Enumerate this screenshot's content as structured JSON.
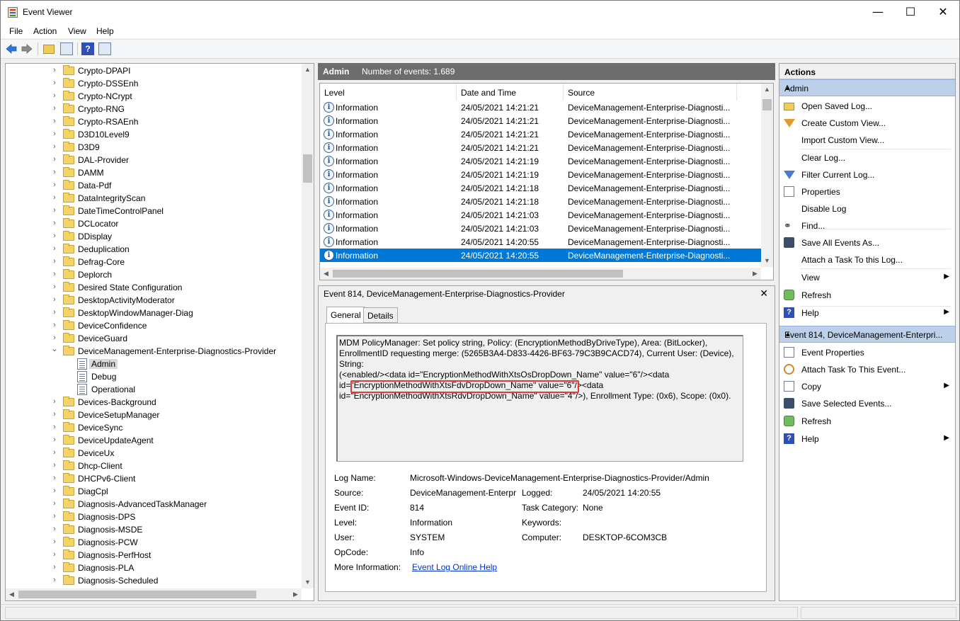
{
  "window": {
    "title": "Event Viewer",
    "minimize": "—",
    "maximize": "☐",
    "close": "✕"
  },
  "menu": [
    "File",
    "Action",
    "View",
    "Help"
  ],
  "toolbar": {
    "help_glyph": "?"
  },
  "tree": {
    "items": [
      {
        "label": "Crypto-DPAPI",
        "type": "folder",
        "expanded": false
      },
      {
        "label": "Crypto-DSSEnh",
        "type": "folder",
        "expanded": false
      },
      {
        "label": "Crypto-NCrypt",
        "type": "folder",
        "expanded": false
      },
      {
        "label": "Crypto-RNG",
        "type": "folder",
        "expanded": false
      },
      {
        "label": "Crypto-RSAEnh",
        "type": "folder",
        "expanded": false
      },
      {
        "label": "D3D10Level9",
        "type": "folder",
        "expanded": false
      },
      {
        "label": "D3D9",
        "type": "folder",
        "expanded": false
      },
      {
        "label": "DAL-Provider",
        "type": "folder",
        "expanded": false
      },
      {
        "label": "DAMM",
        "type": "folder",
        "expanded": false
      },
      {
        "label": "Data-Pdf",
        "type": "folder",
        "expanded": false
      },
      {
        "label": "DataIntegrityScan",
        "type": "folder",
        "expanded": false
      },
      {
        "label": "DateTimeControlPanel",
        "type": "folder",
        "expanded": false
      },
      {
        "label": "DCLocator",
        "type": "folder",
        "expanded": false
      },
      {
        "label": "DDisplay",
        "type": "folder",
        "expanded": false
      },
      {
        "label": "Deduplication",
        "type": "folder",
        "expanded": false
      },
      {
        "label": "Defrag-Core",
        "type": "folder",
        "expanded": false
      },
      {
        "label": "Deplorch",
        "type": "folder",
        "expanded": false
      },
      {
        "label": "Desired State Configuration",
        "type": "folder",
        "expanded": false
      },
      {
        "label": "DesktopActivityModerator",
        "type": "folder",
        "expanded": false
      },
      {
        "label": "DesktopWindowManager-Diag",
        "type": "folder",
        "expanded": false
      },
      {
        "label": "DeviceConfidence",
        "type": "folder",
        "expanded": false
      },
      {
        "label": "DeviceGuard",
        "type": "folder",
        "expanded": false
      },
      {
        "label": "DeviceManagement-Enterprise-Diagnostics-Provider",
        "type": "folder",
        "expanded": true
      },
      {
        "label": "Admin",
        "type": "log",
        "child": true,
        "selected": true
      },
      {
        "label": "Debug",
        "type": "log",
        "child": true
      },
      {
        "label": "Operational",
        "type": "log",
        "child": true
      },
      {
        "label": "Devices-Background",
        "type": "folder",
        "expanded": false
      },
      {
        "label": "DeviceSetupManager",
        "type": "folder",
        "expanded": false
      },
      {
        "label": "DeviceSync",
        "type": "folder",
        "expanded": false
      },
      {
        "label": "DeviceUpdateAgent",
        "type": "folder",
        "expanded": false
      },
      {
        "label": "DeviceUx",
        "type": "folder",
        "expanded": false
      },
      {
        "label": "Dhcp-Client",
        "type": "folder",
        "expanded": false
      },
      {
        "label": "DHCPv6-Client",
        "type": "folder",
        "expanded": false
      },
      {
        "label": "DiagCpl",
        "type": "folder",
        "expanded": false
      },
      {
        "label": "Diagnosis-AdvancedTaskManager",
        "type": "folder",
        "expanded": false
      },
      {
        "label": "Diagnosis-DPS",
        "type": "folder",
        "expanded": false
      },
      {
        "label": "Diagnosis-MSDE",
        "type": "folder",
        "expanded": false
      },
      {
        "label": "Diagnosis-PCW",
        "type": "folder",
        "expanded": false
      },
      {
        "label": "Diagnosis-PerfHost",
        "type": "folder",
        "expanded": false
      },
      {
        "label": "Diagnosis-PLA",
        "type": "folder",
        "expanded": false
      },
      {
        "label": "Diagnosis-Scheduled",
        "type": "folder",
        "expanded": false
      }
    ]
  },
  "log_header": {
    "name": "Admin",
    "count": "Number of events: 1.689"
  },
  "event_list": {
    "columns": [
      "Level",
      "Date and Time",
      "Source"
    ],
    "rows": [
      {
        "level": "Information",
        "date": "24/05/2021 14:21:21",
        "source": "DeviceManagement-Enterprise-Diagnosti..."
      },
      {
        "level": "Information",
        "date": "24/05/2021 14:21:21",
        "source": "DeviceManagement-Enterprise-Diagnosti..."
      },
      {
        "level": "Information",
        "date": "24/05/2021 14:21:21",
        "source": "DeviceManagement-Enterprise-Diagnosti..."
      },
      {
        "level": "Information",
        "date": "24/05/2021 14:21:21",
        "source": "DeviceManagement-Enterprise-Diagnosti..."
      },
      {
        "level": "Information",
        "date": "24/05/2021 14:21:19",
        "source": "DeviceManagement-Enterprise-Diagnosti..."
      },
      {
        "level": "Information",
        "date": "24/05/2021 14:21:19",
        "source": "DeviceManagement-Enterprise-Diagnosti..."
      },
      {
        "level": "Information",
        "date": "24/05/2021 14:21:18",
        "source": "DeviceManagement-Enterprise-Diagnosti..."
      },
      {
        "level": "Information",
        "date": "24/05/2021 14:21:18",
        "source": "DeviceManagement-Enterprise-Diagnosti..."
      },
      {
        "level": "Information",
        "date": "24/05/2021 14:21:03",
        "source": "DeviceManagement-Enterprise-Diagnosti..."
      },
      {
        "level": "Information",
        "date": "24/05/2021 14:21:03",
        "source": "DeviceManagement-Enterprise-Diagnosti..."
      },
      {
        "level": "Information",
        "date": "24/05/2021 14:20:55",
        "source": "DeviceManagement-Enterprise-Diagnosti..."
      },
      {
        "level": "Information",
        "date": "24/05/2021 14:20:55",
        "source": "DeviceManagement-Enterprise-Diagnosti...",
        "selected": true
      }
    ]
  },
  "detail": {
    "title": "Event 814, DeviceManagement-Enterprise-Diagnostics-Provider",
    "close": "✕",
    "tabs": [
      "General",
      "Details"
    ],
    "message_lines": [
      "MDM PolicyManager: Set policy string, Policy: (EncryptionMethodByDriveType), Area: (BitLocker),",
      "EnrollmentID requesting merge: (5265B3A4-D833-4426-BF63-79C3B9CACD74), Current User: (Device), String:",
      "(<enabled/><data id=\"EncryptionMethodWithXtsOsDropDown_Name\" value=\"6\"/><data",
      "id=\"EncryptionMethodWithXtsFdvDropDown_Name\" value=\"6\"/><data",
      "id=\"EncryptionMethodWithXtsRdvDropDown_Name\" value=\"4\"/>), Enrollment Type: (0x6), Scope: (0x0)."
    ],
    "props": {
      "log_name_label": "Log Name:",
      "log_name": "Microsoft-Windows-DeviceManagement-Enterprise-Diagnostics-Provider/Admin",
      "source_label": "Source:",
      "source": "DeviceManagement-Enterpr",
      "logged_label": "Logged:",
      "logged": "24/05/2021 14:20:55",
      "event_id_label": "Event ID:",
      "event_id": "814",
      "task_category_label": "Task Category:",
      "task_category": "None",
      "level_label": "Level:",
      "level": "Information",
      "keywords_label": "Keywords:",
      "keywords": "",
      "user_label": "User:",
      "user": "SYSTEM",
      "computer_label": "Computer:",
      "computer": "DESKTOP-6COM3CB",
      "opcode_label": "OpCode:",
      "opcode": "Info",
      "more_info_label": "More Information:",
      "more_info_link": "Event Log Online Help"
    }
  },
  "actions": {
    "title": "Actions",
    "section1": "Admin",
    "section1_items": [
      {
        "label": "Open Saved Log...",
        "icon": "folder-open-icon"
      },
      {
        "label": "Create Custom View...",
        "icon": "filter-create-icon"
      },
      {
        "label": "Import Custom View...",
        "icon": ""
      },
      {
        "label": "Clear Log...",
        "icon": ""
      },
      {
        "label": "Filter Current Log...",
        "icon": "filter-icon"
      },
      {
        "label": "Properties",
        "icon": "properties-icon"
      },
      {
        "label": "Disable Log",
        "icon": ""
      },
      {
        "label": "Find...",
        "icon": "binoculars-icon"
      },
      {
        "label": "Save All Events As...",
        "icon": "save-icon"
      },
      {
        "label": "Attach a Task To this Log...",
        "icon": ""
      },
      {
        "label": "View",
        "icon": "",
        "submenu": true
      },
      {
        "label": "Refresh",
        "icon": "refresh-icon"
      },
      {
        "label": "Help",
        "icon": "help-icon",
        "submenu": true
      }
    ],
    "section2": "Event 814, DeviceManagement-Enterpri...",
    "section2_items": [
      {
        "label": "Event Properties",
        "icon": "properties-icon"
      },
      {
        "label": "Attach Task To This Event...",
        "icon": "clock-icon"
      },
      {
        "label": "Copy",
        "icon": "copy-icon",
        "submenu": true
      },
      {
        "label": "Save Selected Events...",
        "icon": "save-icon"
      },
      {
        "label": "Refresh",
        "icon": "refresh-icon"
      },
      {
        "label": "Help",
        "icon": "help-icon",
        "submenu": true
      }
    ]
  }
}
